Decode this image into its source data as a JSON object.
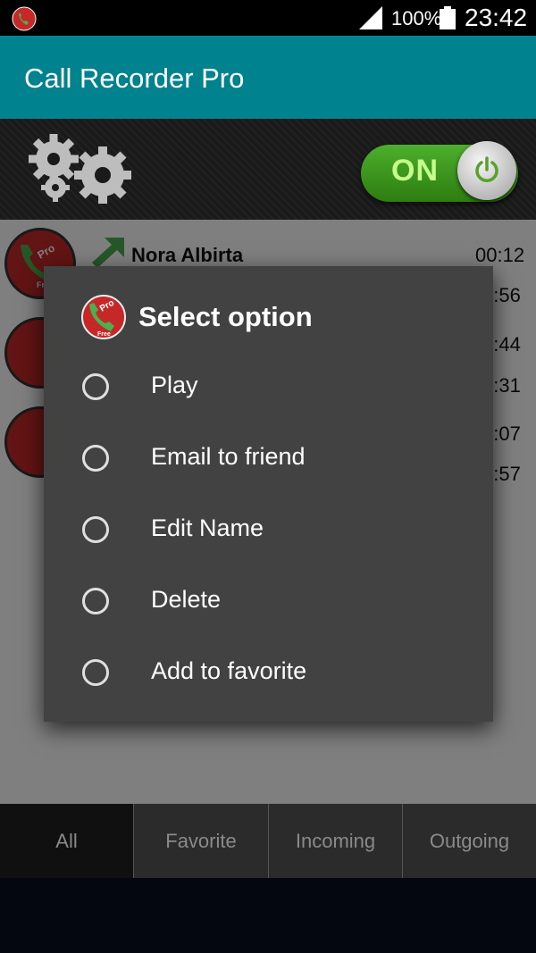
{
  "status_bar": {
    "battery": "100%",
    "time": "23:42"
  },
  "app": {
    "title": "Call Recorder Pro"
  },
  "controls": {
    "toggle_label": "ON",
    "toggle_state": "on"
  },
  "logo": {
    "badge_top": "Pro",
    "badge_bottom": "Free"
  },
  "recordings": [
    {
      "name": "Nora Albirta",
      "time": "00:12",
      "direction": "outgoing"
    },
    {
      "name": "",
      "time": "0:56"
    },
    {
      "name": "",
      "time": "0:44"
    },
    {
      "name": "",
      "time": "1:31"
    },
    {
      "name": "",
      "time": "1:07"
    },
    {
      "name": "",
      "time": "1:57"
    }
  ],
  "dialog": {
    "title": "Select option",
    "options": [
      "Play",
      "Email to friend",
      "Edit Name",
      "Delete",
      "Add to favorite"
    ]
  },
  "tabs": [
    "All",
    "Favorite",
    "Incoming",
    "Outgoing"
  ],
  "colors": {
    "action_bar": "#00838f",
    "toggle_green": "#4caf2b",
    "dialog_bg": "#424242",
    "badge_red": "#c62828"
  }
}
